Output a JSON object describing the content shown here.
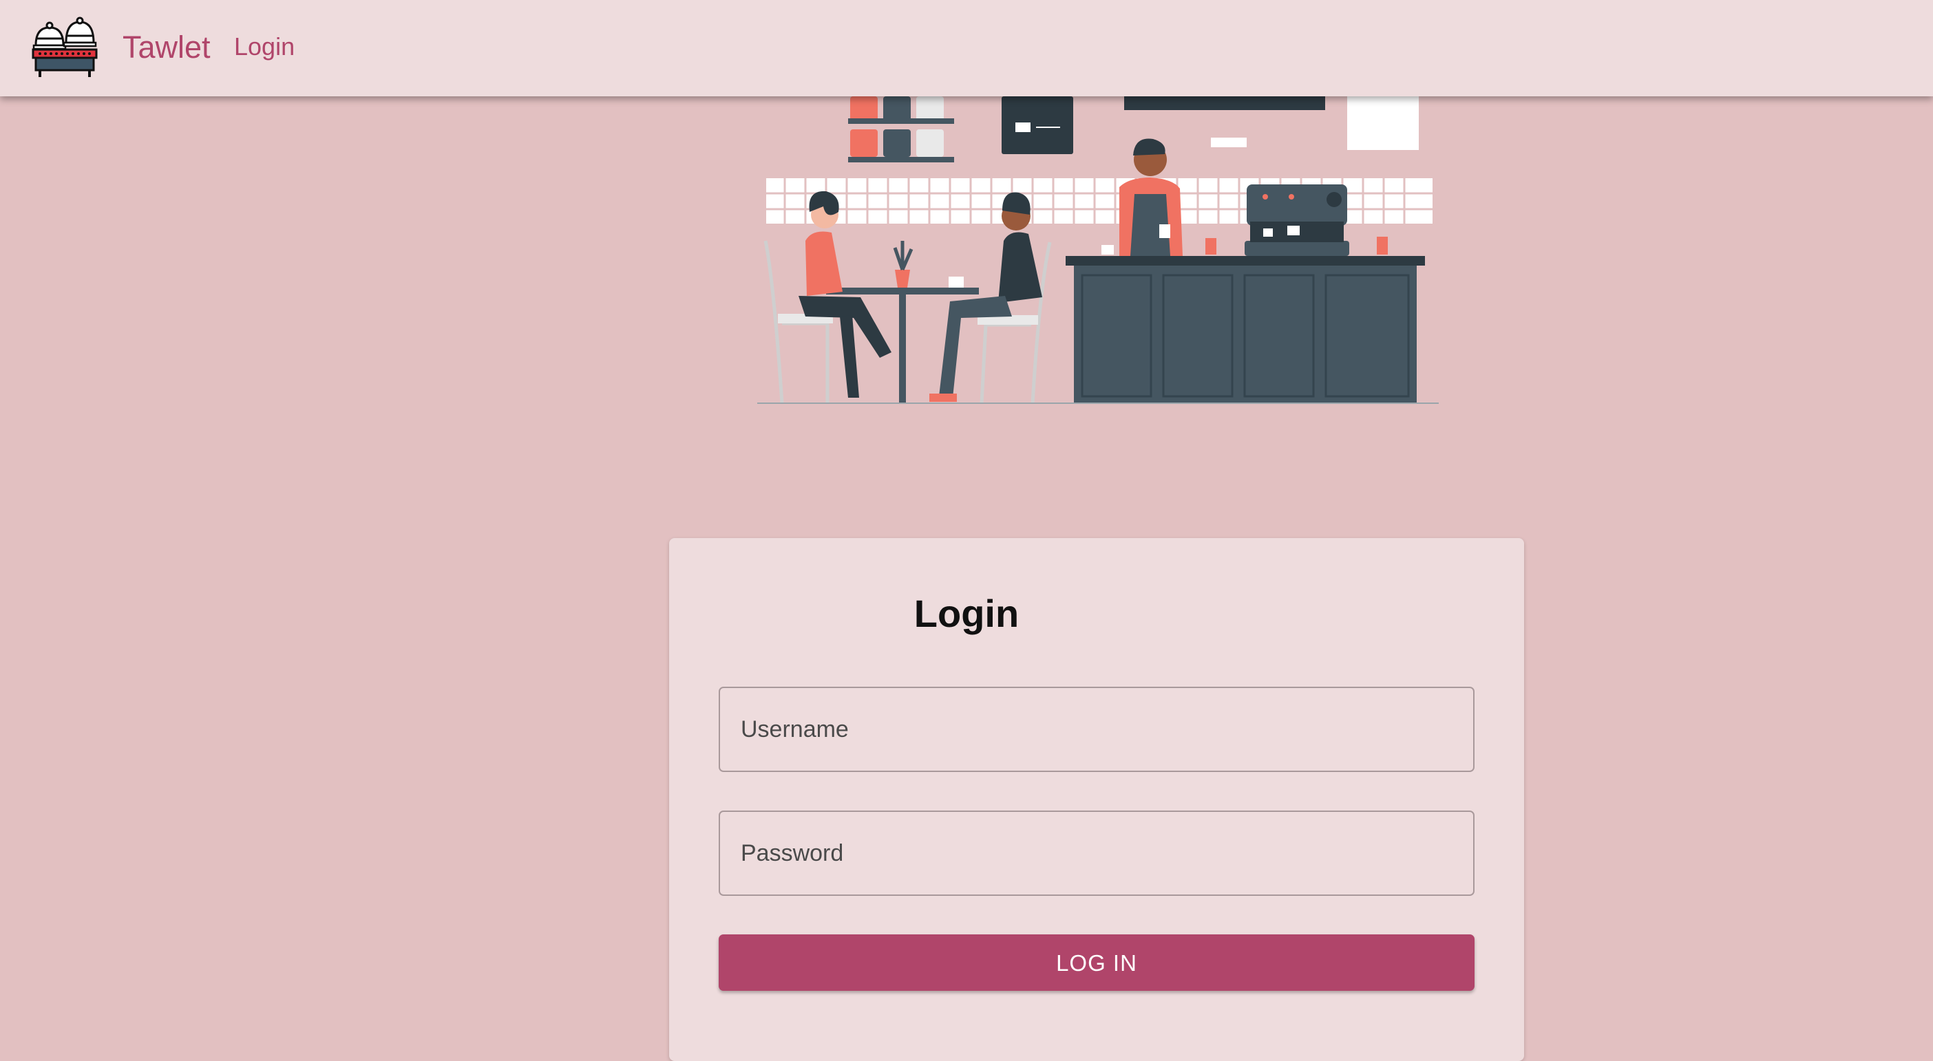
{
  "appbar": {
    "brand": "Tawlet",
    "nav_login": "Login",
    "logo_icon": "food-cloche-table-icon"
  },
  "hero": {
    "illustration": "coffee-shop-illustration"
  },
  "login_card": {
    "title": "Login",
    "username_placeholder": "Username",
    "password_placeholder": "Password",
    "submit_label": "LOG IN"
  },
  "colors": {
    "page_background": "#e2c0c1",
    "surface": "#eedcdd",
    "accent": "#b0456a",
    "illustration_coral": "#f07262",
    "illustration_slate": "#455661"
  }
}
